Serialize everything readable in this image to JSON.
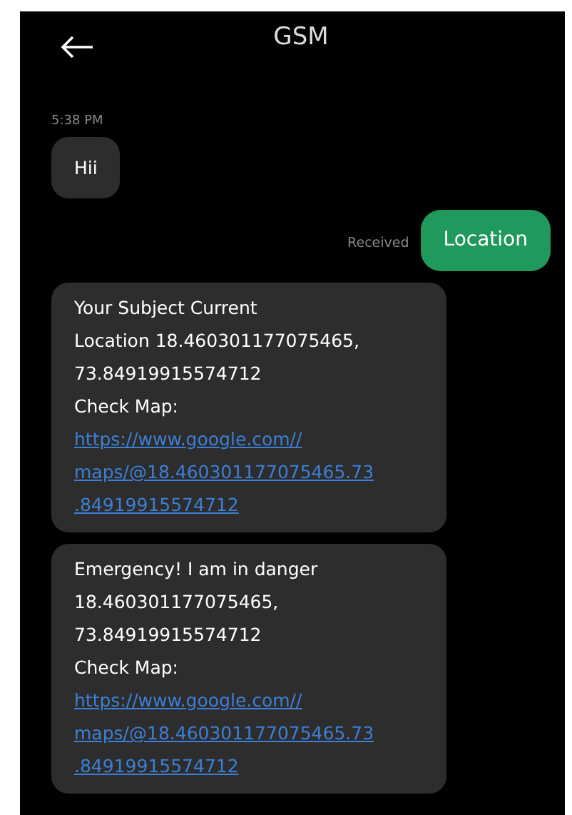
{
  "header": {
    "title": "GSM"
  },
  "timestamp": "5:38 PM",
  "messages": [
    {
      "kind": "incoming",
      "lines": [
        {
          "kind": "text",
          "text": "Hii"
        }
      ]
    },
    {
      "kind": "outgoing",
      "status": "Received",
      "lines": [
        {
          "kind": "text",
          "text": "Location"
        }
      ]
    },
    {
      "kind": "incoming",
      "lines": [
        {
          "kind": "text",
          "text": "Your Subject Current"
        },
        {
          "kind": "text",
          "text": "Location 18.460301177075465,"
        },
        {
          "kind": "text",
          "text": "73.84919915574712"
        },
        {
          "kind": "text",
          "text": "Check Map:"
        },
        {
          "kind": "link",
          "text": "https://www.google.com//"
        },
        {
          "kind": "link",
          "text": "maps/@18.460301177075465.73"
        },
        {
          "kind": "link",
          "text": ".84919915574712"
        }
      ]
    },
    {
      "kind": "incoming",
      "lines": [
        {
          "kind": "text",
          "text": "Emergency! I am in danger"
        },
        {
          "kind": "text",
          "text": "18.460301177075465,"
        },
        {
          "kind": "text",
          "text": "73.84919915574712"
        },
        {
          "kind": "text",
          "text": "Check Map:"
        },
        {
          "kind": "link",
          "text": "https://www.google.com//"
        },
        {
          "kind": "link",
          "text": "maps/@18.460301177075465.73"
        },
        {
          "kind": "link",
          "text": ".84919915574712"
        }
      ]
    }
  ]
}
